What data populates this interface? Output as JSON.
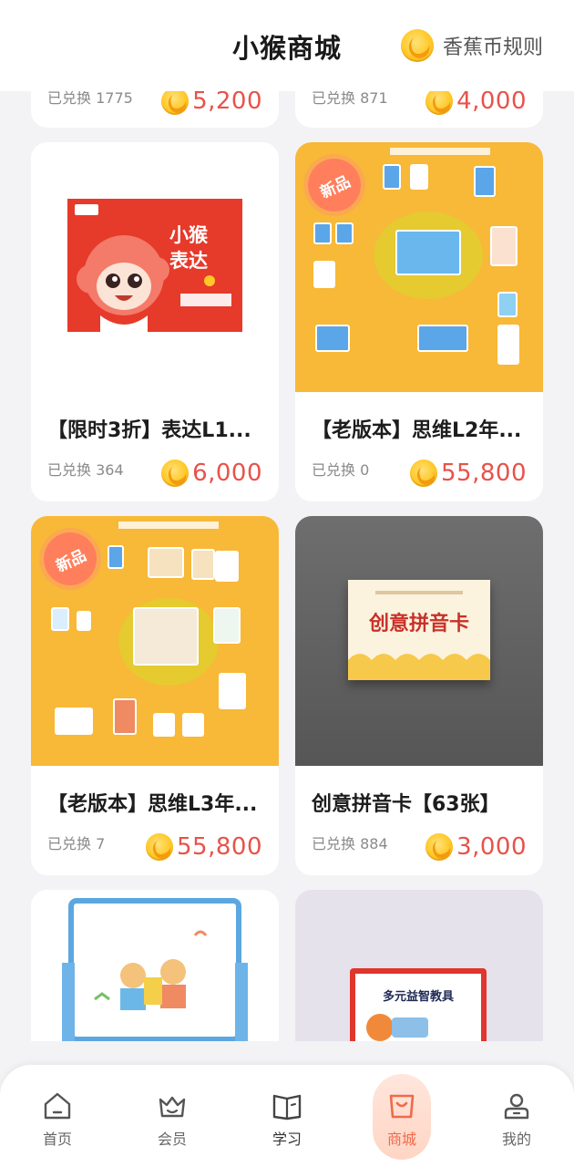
{
  "header": {
    "title": "小猴商城",
    "rules_label": "香蕉币规则"
  },
  "products": [
    {
      "name": "",
      "sold": "已兑换 1775",
      "price": "5,200"
    },
    {
      "name": "",
      "sold": "已兑换 871",
      "price": "4,000"
    },
    {
      "name": "【限时3折】表达L1...",
      "sold": "已兑换 364",
      "price": "6,000",
      "image_text": [
        "小猴",
        "表达"
      ]
    },
    {
      "name": "【老版本】思维L2年...",
      "sold": "已兑换 0",
      "price": "55,800",
      "badge": "新品"
    },
    {
      "name": "【老版本】思维L3年...",
      "sold": "已兑换 7",
      "price": "55,800",
      "badge": "新品"
    },
    {
      "name": "创意拼音卡【63张】",
      "sold": "已兑换 884",
      "price": "3,000",
      "image_text": "创意拼音卡"
    },
    {
      "name": "",
      "sold": "",
      "price": ""
    },
    {
      "name": "",
      "sold": "",
      "price": "",
      "image_text": "多元益智教具"
    }
  ],
  "tabbar": {
    "items": [
      {
        "label": "首页",
        "icon": "home-icon"
      },
      {
        "label": "会员",
        "icon": "crown-basket-icon"
      },
      {
        "label": "学习",
        "icon": "book-icon"
      },
      {
        "label": "商城",
        "icon": "shop-bag-icon",
        "active": true
      },
      {
        "label": "我的",
        "icon": "person-icon"
      }
    ]
  },
  "colors": {
    "accent": "#f06a4a",
    "price": "#e8524a",
    "coin": "#ffc828"
  }
}
